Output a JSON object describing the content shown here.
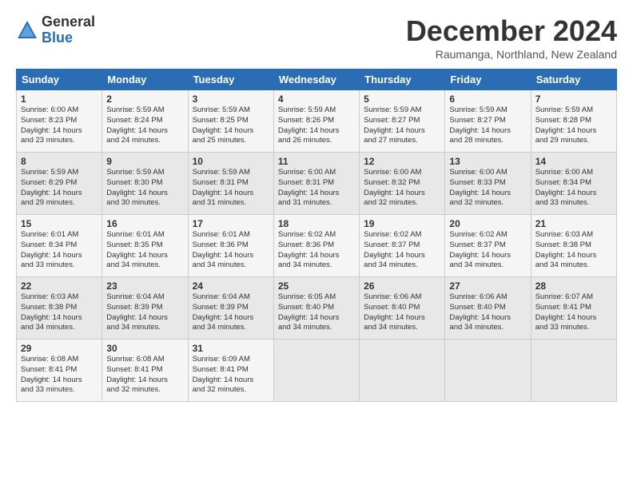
{
  "header": {
    "logo_general": "General",
    "logo_blue": "Blue",
    "month_title": "December 2024",
    "location": "Raumanga, Northland, New Zealand"
  },
  "weekdays": [
    "Sunday",
    "Monday",
    "Tuesday",
    "Wednesday",
    "Thursday",
    "Friday",
    "Saturday"
  ],
  "weeks": [
    [
      {
        "day": "1",
        "info": "Sunrise: 6:00 AM\nSunset: 8:23 PM\nDaylight: 14 hours\nand 23 minutes."
      },
      {
        "day": "2",
        "info": "Sunrise: 5:59 AM\nSunset: 8:24 PM\nDaylight: 14 hours\nand 24 minutes."
      },
      {
        "day": "3",
        "info": "Sunrise: 5:59 AM\nSunset: 8:25 PM\nDaylight: 14 hours\nand 25 minutes."
      },
      {
        "day": "4",
        "info": "Sunrise: 5:59 AM\nSunset: 8:26 PM\nDaylight: 14 hours\nand 26 minutes."
      },
      {
        "day": "5",
        "info": "Sunrise: 5:59 AM\nSunset: 8:27 PM\nDaylight: 14 hours\nand 27 minutes."
      },
      {
        "day": "6",
        "info": "Sunrise: 5:59 AM\nSunset: 8:27 PM\nDaylight: 14 hours\nand 28 minutes."
      },
      {
        "day": "7",
        "info": "Sunrise: 5:59 AM\nSunset: 8:28 PM\nDaylight: 14 hours\nand 29 minutes."
      }
    ],
    [
      {
        "day": "8",
        "info": "Sunrise: 5:59 AM\nSunset: 8:29 PM\nDaylight: 14 hours\nand 29 minutes."
      },
      {
        "day": "9",
        "info": "Sunrise: 5:59 AM\nSunset: 8:30 PM\nDaylight: 14 hours\nand 30 minutes."
      },
      {
        "day": "10",
        "info": "Sunrise: 5:59 AM\nSunset: 8:31 PM\nDaylight: 14 hours\nand 31 minutes."
      },
      {
        "day": "11",
        "info": "Sunrise: 6:00 AM\nSunset: 8:31 PM\nDaylight: 14 hours\nand 31 minutes."
      },
      {
        "day": "12",
        "info": "Sunrise: 6:00 AM\nSunset: 8:32 PM\nDaylight: 14 hours\nand 32 minutes."
      },
      {
        "day": "13",
        "info": "Sunrise: 6:00 AM\nSunset: 8:33 PM\nDaylight: 14 hours\nand 32 minutes."
      },
      {
        "day": "14",
        "info": "Sunrise: 6:00 AM\nSunset: 8:34 PM\nDaylight: 14 hours\nand 33 minutes."
      }
    ],
    [
      {
        "day": "15",
        "info": "Sunrise: 6:01 AM\nSunset: 8:34 PM\nDaylight: 14 hours\nand 33 minutes."
      },
      {
        "day": "16",
        "info": "Sunrise: 6:01 AM\nSunset: 8:35 PM\nDaylight: 14 hours\nand 34 minutes."
      },
      {
        "day": "17",
        "info": "Sunrise: 6:01 AM\nSunset: 8:36 PM\nDaylight: 14 hours\nand 34 minutes."
      },
      {
        "day": "18",
        "info": "Sunrise: 6:02 AM\nSunset: 8:36 PM\nDaylight: 14 hours\nand 34 minutes."
      },
      {
        "day": "19",
        "info": "Sunrise: 6:02 AM\nSunset: 8:37 PM\nDaylight: 14 hours\nand 34 minutes."
      },
      {
        "day": "20",
        "info": "Sunrise: 6:02 AM\nSunset: 8:37 PM\nDaylight: 14 hours\nand 34 minutes."
      },
      {
        "day": "21",
        "info": "Sunrise: 6:03 AM\nSunset: 8:38 PM\nDaylight: 14 hours\nand 34 minutes."
      }
    ],
    [
      {
        "day": "22",
        "info": "Sunrise: 6:03 AM\nSunset: 8:38 PM\nDaylight: 14 hours\nand 34 minutes."
      },
      {
        "day": "23",
        "info": "Sunrise: 6:04 AM\nSunset: 8:39 PM\nDaylight: 14 hours\nand 34 minutes."
      },
      {
        "day": "24",
        "info": "Sunrise: 6:04 AM\nSunset: 8:39 PM\nDaylight: 14 hours\nand 34 minutes."
      },
      {
        "day": "25",
        "info": "Sunrise: 6:05 AM\nSunset: 8:40 PM\nDaylight: 14 hours\nand 34 minutes."
      },
      {
        "day": "26",
        "info": "Sunrise: 6:06 AM\nSunset: 8:40 PM\nDaylight: 14 hours\nand 34 minutes."
      },
      {
        "day": "27",
        "info": "Sunrise: 6:06 AM\nSunset: 8:40 PM\nDaylight: 14 hours\nand 34 minutes."
      },
      {
        "day": "28",
        "info": "Sunrise: 6:07 AM\nSunset: 8:41 PM\nDaylight: 14 hours\nand 33 minutes."
      }
    ],
    [
      {
        "day": "29",
        "info": "Sunrise: 6:08 AM\nSunset: 8:41 PM\nDaylight: 14 hours\nand 33 minutes."
      },
      {
        "day": "30",
        "info": "Sunrise: 6:08 AM\nSunset: 8:41 PM\nDaylight: 14 hours\nand 32 minutes."
      },
      {
        "day": "31",
        "info": "Sunrise: 6:09 AM\nSunset: 8:41 PM\nDaylight: 14 hours\nand 32 minutes."
      },
      null,
      null,
      null,
      null
    ]
  ]
}
